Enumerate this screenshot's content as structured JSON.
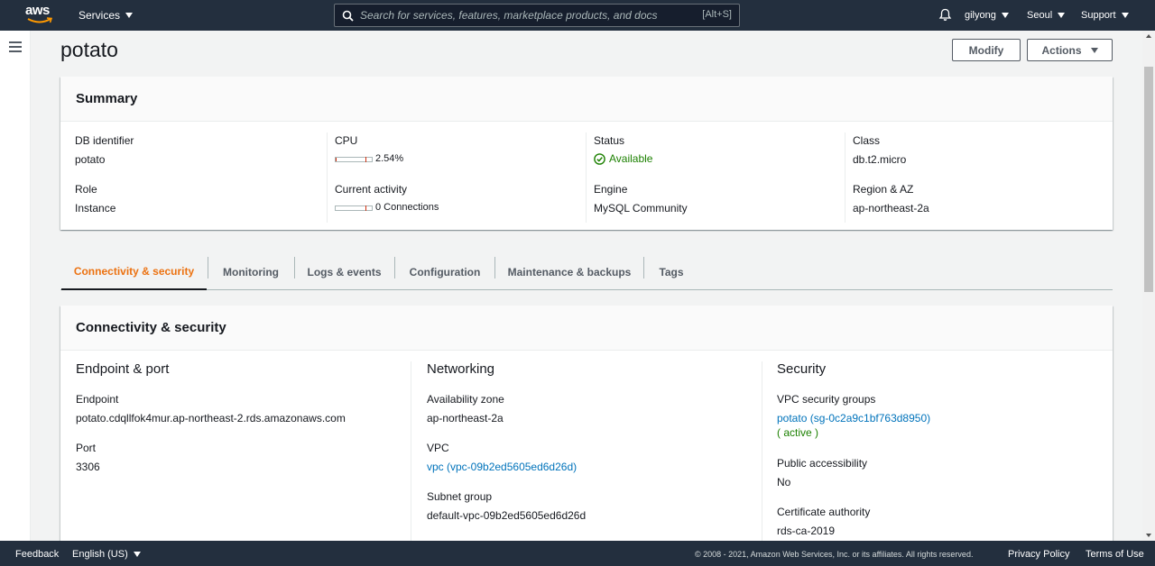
{
  "topnav": {
    "logo_text": "aws",
    "services_label": "Services",
    "search_placeholder": "Search for services, features, marketplace products, and docs",
    "search_shortcut": "[Alt+S]",
    "user_label": "gilyong",
    "region_label": "Seoul",
    "support_label": "Support"
  },
  "page": {
    "title": "potato",
    "modify_label": "Modify",
    "actions_label": "Actions"
  },
  "summary": {
    "title": "Summary",
    "db_identifier_label": "DB identifier",
    "db_identifier_value": "potato",
    "role_label": "Role",
    "role_value": "Instance",
    "cpu_label": "CPU",
    "cpu_value": "2.54%",
    "cpu_fraction": 0.0254,
    "activity_label": "Current activity",
    "activity_value": "0 Connections",
    "status_label": "Status",
    "status_value": "Available",
    "engine_label": "Engine",
    "engine_value": "MySQL Community",
    "class_label": "Class",
    "class_value": "db.t2.micro",
    "region_label": "Region & AZ",
    "region_value": "ap-northeast-2a"
  },
  "tabs": [
    {
      "label": "Connectivity & security",
      "active": true
    },
    {
      "label": "Monitoring",
      "active": false
    },
    {
      "label": "Logs & events",
      "active": false
    },
    {
      "label": "Configuration",
      "active": false
    },
    {
      "label": "Maintenance & backups",
      "active": false
    },
    {
      "label": "Tags",
      "active": false
    }
  ],
  "connectivity": {
    "title": "Connectivity & security",
    "endpoint_port": {
      "title": "Endpoint & port",
      "endpoint_label": "Endpoint",
      "endpoint_value": "potato.cdqllfok4mur.ap-northeast-2.rds.amazonaws.com",
      "port_label": "Port",
      "port_value": "3306"
    },
    "networking": {
      "title": "Networking",
      "az_label": "Availability zone",
      "az_value": "ap-northeast-2a",
      "vpc_label": "VPC",
      "vpc_value": "vpc (vpc-09b2ed5605ed6d26d)",
      "subnet_label": "Subnet group",
      "subnet_value": "default-vpc-09b2ed5605ed6d26d"
    },
    "security": {
      "title": "Security",
      "sg_label": "VPC security groups",
      "sg_value": "potato (sg-0c2a9c1bf763d8950)",
      "sg_status": "( active )",
      "public_label": "Public accessibility",
      "public_value": "No",
      "ca_label": "Certificate authority",
      "ca_value": "rds-ca-2019"
    }
  },
  "footer": {
    "feedback": "Feedback",
    "language": "English (US)",
    "copyright": "© 2008 - 2021, Amazon Web Services, Inc. or its affiliates. All rights reserved.",
    "privacy": "Privacy Policy",
    "terms": "Terms of Use"
  },
  "colors": {
    "nav_bg": "#232f3e",
    "accent_orange": "#ec7211",
    "link_blue": "#0073bb",
    "status_green": "#1d8102"
  }
}
